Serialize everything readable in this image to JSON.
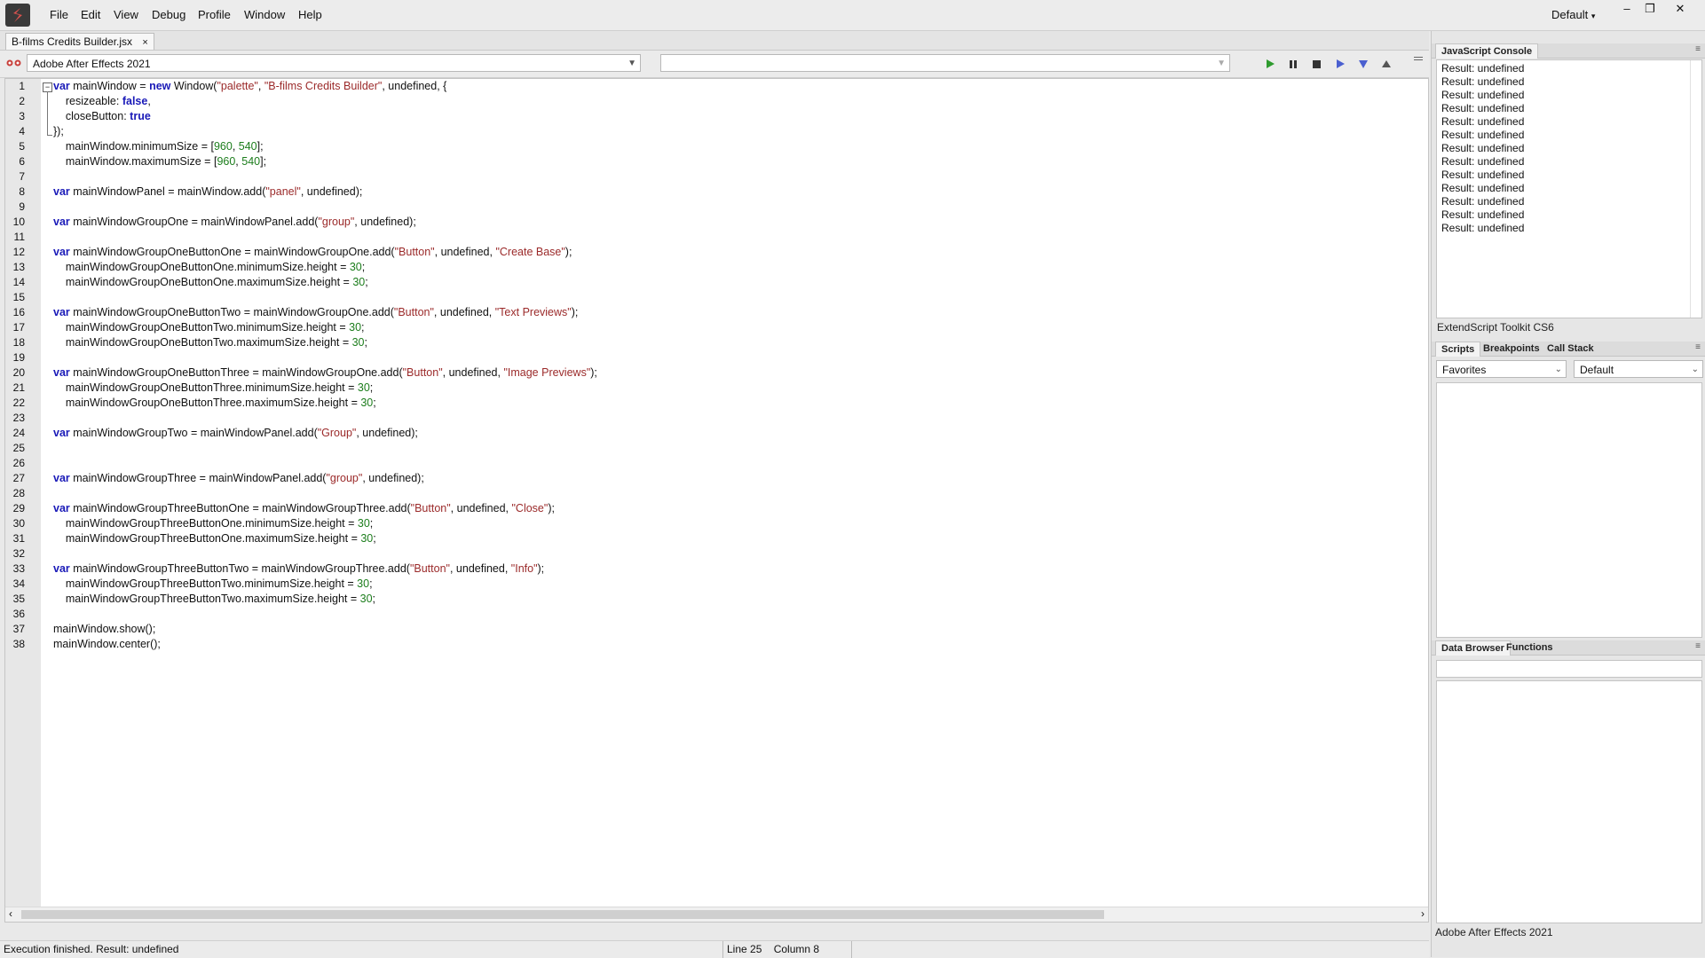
{
  "menubar": {
    "items": [
      "File",
      "Edit",
      "View",
      "Debug",
      "Profile",
      "Window",
      "Help"
    ],
    "workspace": "Default",
    "window_buttons": [
      "–",
      "❐",
      "✕"
    ]
  },
  "tab": {
    "label": "B-films Credits Builder.jsx",
    "close": "×"
  },
  "toolbar": {
    "target_app": "Adobe After Effects 2021",
    "engine": ""
  },
  "editor": {
    "lines": [
      [
        [
          "kw",
          "var"
        ],
        [
          "t",
          " mainWindow = "
        ],
        [
          "kw",
          "new"
        ],
        [
          "t",
          " Window("
        ],
        [
          "str",
          "\"palette\""
        ],
        [
          "t",
          ", "
        ],
        [
          "str",
          "\"B-films Credits Builder\""
        ],
        [
          "t",
          ", undefined, {"
        ]
      ],
      [
        [
          "t",
          "    resizeable: "
        ],
        [
          "kw",
          "false"
        ],
        [
          "t",
          ","
        ]
      ],
      [
        [
          "t",
          "    closeButton: "
        ],
        [
          "kw",
          "true"
        ]
      ],
      [
        [
          "t",
          "});"
        ]
      ],
      [
        [
          "t",
          "    mainWindow.minimumSize = ["
        ],
        [
          "num",
          "960"
        ],
        [
          "t",
          ", "
        ],
        [
          "num",
          "540"
        ],
        [
          "t",
          "];"
        ]
      ],
      [
        [
          "t",
          "    mainWindow.maximumSize = ["
        ],
        [
          "num",
          "960"
        ],
        [
          "t",
          ", "
        ],
        [
          "num",
          "540"
        ],
        [
          "t",
          "];"
        ]
      ],
      [],
      [
        [
          "kw",
          "var"
        ],
        [
          "t",
          " mainWindowPanel = mainWindow.add("
        ],
        [
          "str",
          "\"panel\""
        ],
        [
          "t",
          ", undefined);"
        ]
      ],
      [],
      [
        [
          "kw",
          "var"
        ],
        [
          "t",
          " mainWindowGroupOne = mainWindowPanel.add("
        ],
        [
          "str",
          "\"group\""
        ],
        [
          "t",
          ", undefined);"
        ]
      ],
      [],
      [
        [
          "kw",
          "var"
        ],
        [
          "t",
          " mainWindowGroupOneButtonOne = mainWindowGroupOne.add("
        ],
        [
          "str",
          "\"Button\""
        ],
        [
          "t",
          ", undefined, "
        ],
        [
          "str",
          "\"Create Base\""
        ],
        [
          "t",
          ");"
        ]
      ],
      [
        [
          "t",
          "    mainWindowGroupOneButtonOne.minimumSize.height = "
        ],
        [
          "num",
          "30"
        ],
        [
          "t",
          ";"
        ]
      ],
      [
        [
          "t",
          "    mainWindowGroupOneButtonOne.maximumSize.height = "
        ],
        [
          "num",
          "30"
        ],
        [
          "t",
          ";"
        ]
      ],
      [],
      [
        [
          "kw",
          "var"
        ],
        [
          "t",
          " mainWindowGroupOneButtonTwo = mainWindowGroupOne.add("
        ],
        [
          "str",
          "\"Button\""
        ],
        [
          "t",
          ", undefined, "
        ],
        [
          "str",
          "\"Text Previews\""
        ],
        [
          "t",
          ");"
        ]
      ],
      [
        [
          "t",
          "    mainWindowGroupOneButtonTwo.minimumSize.height = "
        ],
        [
          "num",
          "30"
        ],
        [
          "t",
          ";"
        ]
      ],
      [
        [
          "t",
          "    mainWindowGroupOneButtonTwo.maximumSize.height = "
        ],
        [
          "num",
          "30"
        ],
        [
          "t",
          ";"
        ]
      ],
      [],
      [
        [
          "kw",
          "var"
        ],
        [
          "t",
          " mainWindowGroupOneButtonThree = mainWindowGroupOne.add("
        ],
        [
          "str",
          "\"Button\""
        ],
        [
          "t",
          ", undefined, "
        ],
        [
          "str",
          "\"Image Previews\""
        ],
        [
          "t",
          ");"
        ]
      ],
      [
        [
          "t",
          "    mainWindowGroupOneButtonThree.minimumSize.height = "
        ],
        [
          "num",
          "30"
        ],
        [
          "t",
          ";"
        ]
      ],
      [
        [
          "t",
          "    mainWindowGroupOneButtonThree.maximumSize.height = "
        ],
        [
          "num",
          "30"
        ],
        [
          "t",
          ";"
        ]
      ],
      [],
      [
        [
          "kw",
          "var"
        ],
        [
          "t",
          " mainWindowGroupTwo = mainWindowPanel.add("
        ],
        [
          "str",
          "\"Group\""
        ],
        [
          "t",
          ", undefined);"
        ]
      ],
      [],
      [],
      [
        [
          "kw",
          "var"
        ],
        [
          "t",
          " mainWindowGroupThree = mainWindowPanel.add("
        ],
        [
          "str",
          "\"group\""
        ],
        [
          "t",
          ", undefined);"
        ]
      ],
      [],
      [
        [
          "kw",
          "var"
        ],
        [
          "t",
          " mainWindowGroupThreeButtonOne = mainWindowGroupThree.add("
        ],
        [
          "str",
          "\"Button\""
        ],
        [
          "t",
          ", undefined, "
        ],
        [
          "str",
          "\"Close\""
        ],
        [
          "t",
          ");"
        ]
      ],
      [
        [
          "t",
          "    mainWindowGroupThreeButtonOne.minimumSize.height = "
        ],
        [
          "num",
          "30"
        ],
        [
          "t",
          ";"
        ]
      ],
      [
        [
          "t",
          "    mainWindowGroupThreeButtonOne.maximumSize.height = "
        ],
        [
          "num",
          "30"
        ],
        [
          "t",
          ";"
        ]
      ],
      [],
      [
        [
          "kw",
          "var"
        ],
        [
          "t",
          " mainWindowGroupThreeButtonTwo = mainWindowGroupThree.add("
        ],
        [
          "str",
          "\"Button\""
        ],
        [
          "t",
          ", undefined, "
        ],
        [
          "str",
          "\"Info\""
        ],
        [
          "t",
          ");"
        ]
      ],
      [
        [
          "t",
          "    mainWindowGroupThreeButtonTwo.minimumSize.height = "
        ],
        [
          "num",
          "30"
        ],
        [
          "t",
          ";"
        ]
      ],
      [
        [
          "t",
          "    mainWindowGroupThreeButtonTwo.maximumSize.height = "
        ],
        [
          "num",
          "30"
        ],
        [
          "t",
          ";"
        ]
      ],
      [],
      [
        [
          "t",
          "mainWindow.show();"
        ]
      ],
      [
        [
          "t",
          "mainWindow.center();"
        ]
      ]
    ]
  },
  "status": {
    "message": "Execution finished. Result: undefined",
    "line": "Line 25",
    "column": "Column 8"
  },
  "console": {
    "tab": "JavaScript Console",
    "lines": [
      "Result: undefined",
      "Result: undefined",
      "Result: undefined",
      "Result: undefined",
      "Result: undefined",
      "Result: undefined",
      "Result: undefined",
      "Result: undefined",
      "Result: undefined",
      "Result: undefined",
      "Result: undefined",
      "Result: undefined",
      "Result: undefined"
    ],
    "title": "ExtendScript Toolkit CS6"
  },
  "scripts_panel": {
    "tabs": [
      "Scripts",
      "Breakpoints",
      "Call Stack"
    ],
    "favorites": "Favorites",
    "default": "Default"
  },
  "data_panel": {
    "tabs": [
      "Data Browser",
      "Functions"
    ],
    "target": "Adobe After Effects 2021"
  },
  "colors": {
    "keyword": "#1a1ab8",
    "string": "#9b2a2a",
    "number": "#1c7d1c",
    "run": "#2e9b2e",
    "step": "#4a5fd0"
  }
}
